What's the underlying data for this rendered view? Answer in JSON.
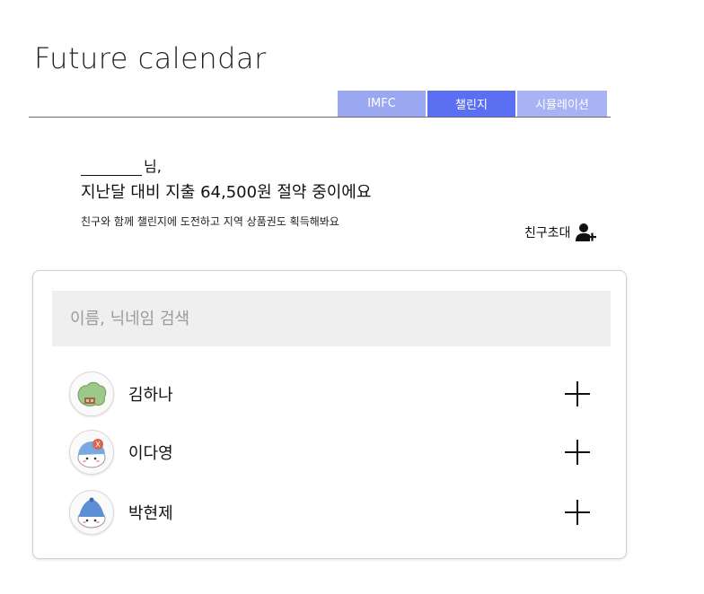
{
  "app": {
    "title": "Future calendar"
  },
  "tabs": [
    {
      "label": "IMFC"
    },
    {
      "label": "챌린지",
      "active": true
    },
    {
      "label": "시뮬레이션"
    }
  ],
  "greeting": {
    "suffix": "님,",
    "headline": "지난달 대비 지출 64,500원 절약 중이에요",
    "subline": "친구와 함께 챌린지에 도전하고 지역 상품권도 획득해봐요"
  },
  "invite": {
    "label": "친구초대",
    "icon": "add-user-icon"
  },
  "search": {
    "placeholder": "이름, 닉네임 검색",
    "value": ""
  },
  "friends": [
    {
      "name": "김하나",
      "avatar": "green-blob-avatar"
    },
    {
      "name": "이다영",
      "avatar": "blue-cap-avatar"
    },
    {
      "name": "박현제",
      "avatar": "blue-hat-avatar"
    }
  ],
  "colors": {
    "tab_active": "#5a6ff1",
    "tab_inactive": "#9aa8f2",
    "tab_inactive_light": "#a7b3f5",
    "search_bg": "#efefef"
  }
}
